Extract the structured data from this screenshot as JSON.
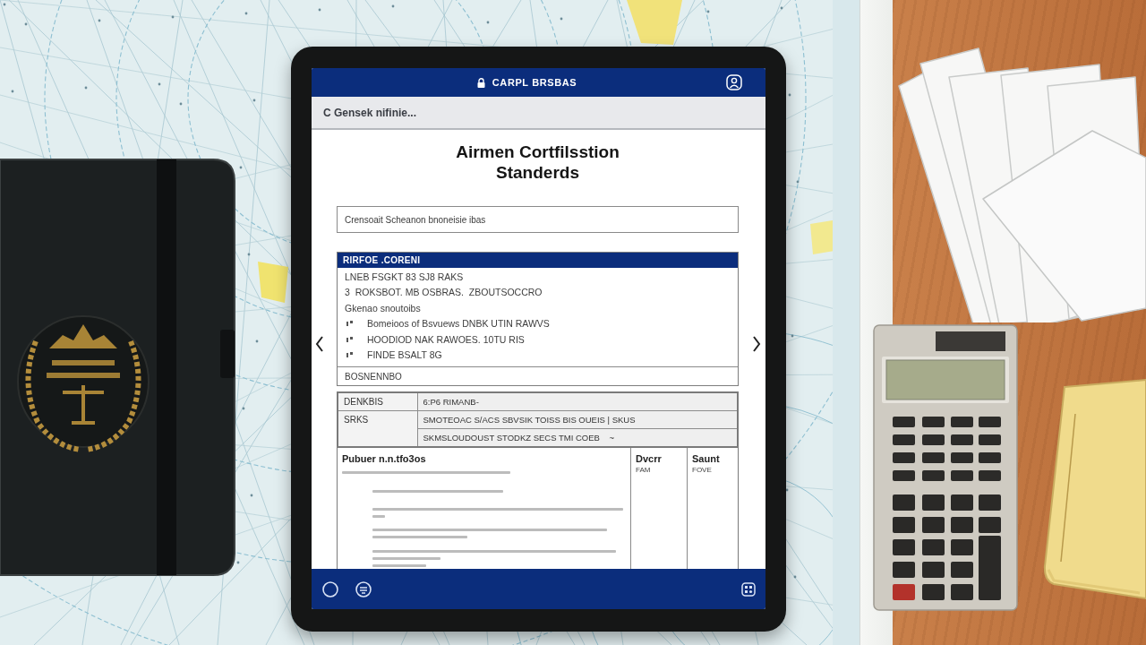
{
  "top_bar": {
    "title": "CARPL BRSBAS"
  },
  "address_bar": {
    "text": "C Gensek nifinie..."
  },
  "heading": [
    "Airmen Cortfilsstion",
    "Standerds"
  ],
  "text_field": {
    "value": "Crensoait Scheanon bnoneisie ibas"
  },
  "section": {
    "header": "RIRFOE .CORENI",
    "lines": [
      {
        "kind": "plain",
        "text": "LNEB FSGKT 83 SJ8 RAKS"
      },
      {
        "kind": "plain",
        "text": "3  ROKSBOT. MB OSBRAS.  ZBOUTSOCCRO"
      },
      {
        "kind": "plain",
        "text": "Gkenao snoutoibs"
      },
      {
        "kind": "bullet",
        "text": "Bomeioos of Bsvuews DNBK UTIN RAWVS"
      },
      {
        "kind": "bullet",
        "text": "HOODIOD NAK RAWOES. 10TU RIS"
      },
      {
        "kind": "bullet",
        "text": "FINDE BSALT 8G"
      }
    ],
    "footer": "BOSNENNBO"
  },
  "summary_table": {
    "rows": [
      {
        "label": "DENKBIS",
        "values": [
          "6:P6 RIMANB-"
        ]
      },
      {
        "label": "SRKS",
        "values": [
          "SMOTEOAC S/ACS SBVSIK TOISS BIS OUEIS | SKUS",
          "SKMSLOUDOUST STODKZ SECS TMI COEB    ~"
        ]
      }
    ]
  },
  "detail_table": {
    "columns": [
      {
        "heading": "Pubuer n.n.tfo3os"
      },
      {
        "heading": "Dvcrr",
        "subheading": "FAM"
      },
      {
        "heading": "Saunt",
        "subheading": "FOVE"
      }
    ]
  }
}
